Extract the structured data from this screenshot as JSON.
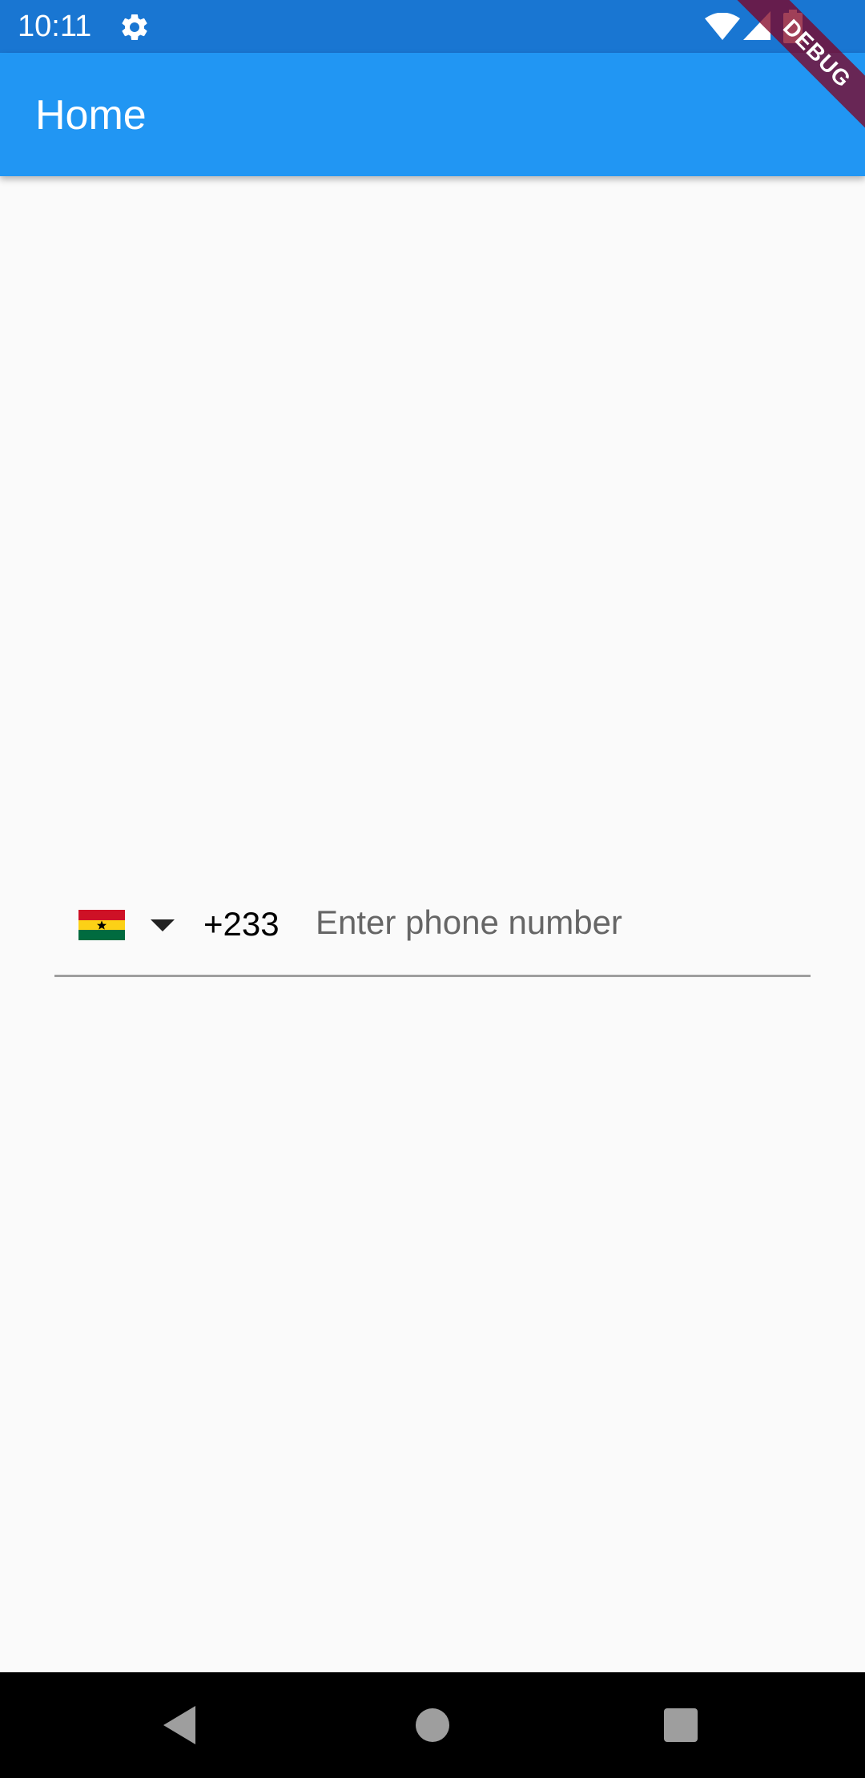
{
  "status_bar": {
    "time": "10:11",
    "icons": [
      "gear-icon",
      "wifi-icon",
      "signal-icon",
      "battery-icon"
    ]
  },
  "app_bar": {
    "title": "Home",
    "color": "#2196f3"
  },
  "debug_banner": {
    "label": "DEBUG"
  },
  "phone_field": {
    "country_flag": "ghana-flag-icon",
    "dial_code": "+233",
    "value": "",
    "placeholder": "Enter phone number"
  },
  "nav_bar": {
    "icons": [
      "back-icon",
      "home-icon",
      "recents-icon"
    ]
  },
  "colors": {
    "status_bar": "#1976d2",
    "app_bar": "#2196f3",
    "background": "#fafafa",
    "underline": "#9e9e9e",
    "placeholder": "#666666"
  }
}
